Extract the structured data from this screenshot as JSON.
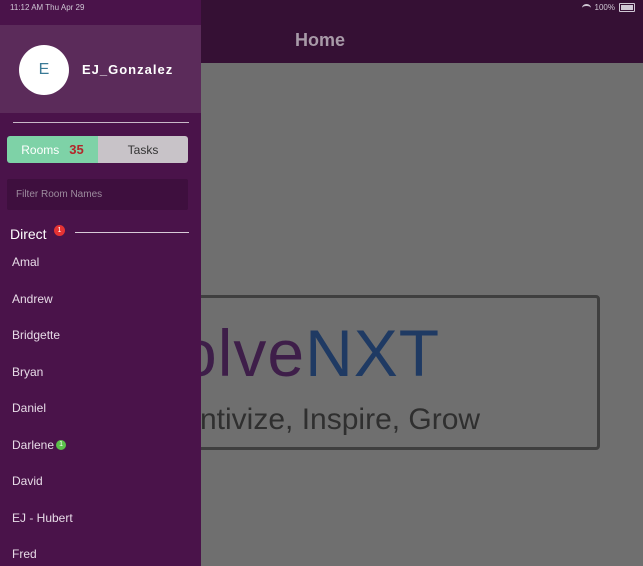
{
  "status_bar": {
    "time": "11:12 AM   Thu Apr 29",
    "battery": "100%"
  },
  "header": {
    "title": "Home"
  },
  "logo": {
    "part1": "olve",
    "part2": "NXT",
    "tagline": "ntivize, Inspire, Grow"
  },
  "drawer": {
    "user": {
      "initial": "E",
      "name": "EJ_Gonzalez"
    },
    "tabs": {
      "rooms_label": "Rooms",
      "rooms_count": "35",
      "tasks_label": "Tasks"
    },
    "filter": {
      "placeholder": "Filter Room Names"
    },
    "section": {
      "title": "Direct",
      "badge": "1"
    },
    "items": [
      {
        "name": "Amal"
      },
      {
        "name": "Andrew"
      },
      {
        "name": "Bridgette"
      },
      {
        "name": "Bryan"
      },
      {
        "name": "Daniel"
      },
      {
        "name": "Darlene",
        "badge": "1"
      },
      {
        "name": "David"
      },
      {
        "name": "EJ - Hubert"
      },
      {
        "name": "Fred"
      }
    ]
  }
}
